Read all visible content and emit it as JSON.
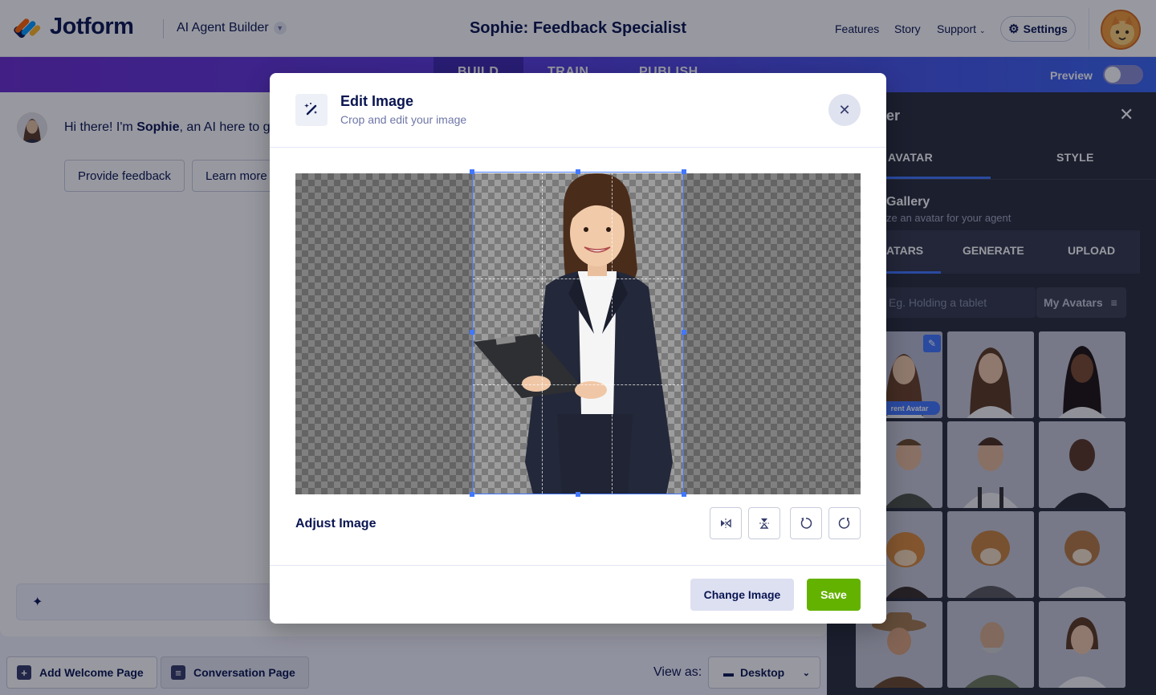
{
  "header": {
    "logo_text": "Jotform",
    "builder_name": "AI Agent Builder",
    "agent_title": "Sophie: Feedback Specialist",
    "nav": {
      "features": "Features",
      "story": "Story",
      "support": "Support"
    },
    "settings_label": "Settings"
  },
  "tabs": {
    "build": "BUILD",
    "train": "TRAIN",
    "publish": "PUBLISH",
    "preview_label": "Preview"
  },
  "chat": {
    "greeting_prefix": "Hi there! I'm ",
    "greeting_name": "Sophie",
    "greeting_rest": ", an AI here to g",
    "quick_replies": [
      "Provide feedback",
      "Learn more"
    ]
  },
  "bottom": {
    "add_welcome": "Add Welcome Page",
    "conversation": "Conversation Page",
    "view_as": "View as:",
    "device": "Desktop"
  },
  "sidepanel": {
    "title": "er",
    "tabs": [
      "AVATAR",
      "STYLE"
    ],
    "gallery_title": "Gallery",
    "gallery_sub": "ze an avatar for your agent",
    "subtabs": [
      "ATARS",
      "GENERATE",
      "UPLOAD"
    ],
    "search_placeholder": "Eg. Holding a tablet",
    "filter_label": "My Avatars",
    "current_badge": "rent Avatar"
  },
  "modal": {
    "title": "Edit Image",
    "subtitle": "Crop and edit your image",
    "adjust_label": "Adjust Image",
    "change_image": "Change Image",
    "save": "Save"
  },
  "colors": {
    "brand_navy": "#0a1551",
    "accent_blue": "#4277ff",
    "save_green": "#64b200"
  }
}
